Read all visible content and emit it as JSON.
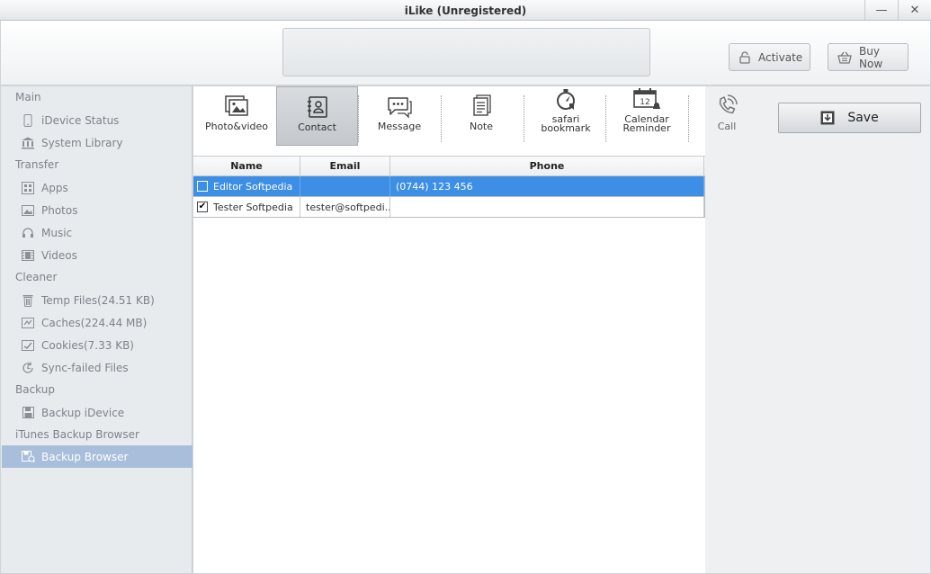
{
  "window": {
    "title": "iLike (Unregistered)",
    "minimize_glyph": "—",
    "close_glyph": "✕"
  },
  "header": {
    "activate_label": "Activate",
    "buy_now_label": "Buy Now"
  },
  "sidebar": {
    "groups": [
      {
        "label": "Main"
      },
      {
        "label": "Transfer"
      },
      {
        "label": "Cleaner"
      },
      {
        "label": "Backup"
      },
      {
        "label": "iTunes Backup Browser"
      }
    ],
    "items": [
      {
        "label": "iDevice Status",
        "icon": "phone-icon"
      },
      {
        "label": "System Library",
        "icon": "library-icon"
      },
      {
        "label": "Apps",
        "icon": "apps-icon"
      },
      {
        "label": "Photos",
        "icon": "photos-icon"
      },
      {
        "label": "Music",
        "icon": "headphones-icon"
      },
      {
        "label": "Videos",
        "icon": "film-icon"
      },
      {
        "label": "Temp Files(24.51 KB)",
        "icon": "trash-icon"
      },
      {
        "label": "Caches(224.44 MB)",
        "icon": "cache-icon"
      },
      {
        "label": "Cookies(7.33 KB)",
        "icon": "cookie-icon"
      },
      {
        "label": "Sync-failed Files",
        "icon": "sync-icon"
      },
      {
        "label": "Backup iDevice",
        "icon": "floppy-icon"
      },
      {
        "label": "Backup Browser",
        "icon": "browser-icon",
        "active": true
      }
    ]
  },
  "toolbar": {
    "tools": [
      {
        "label": "Photo&video",
        "icon": "photo-video-icon"
      },
      {
        "label": "Contact",
        "icon": "contact-icon",
        "active": true
      },
      {
        "label": "Message",
        "icon": "message-icon"
      },
      {
        "label": "Note",
        "icon": "note-icon"
      },
      {
        "label": "safari bookmark",
        "line1": "safari",
        "line2": "bookmark",
        "icon": "compass-icon"
      },
      {
        "label": "Calendar Reminder",
        "line1": "Calendar",
        "line2": "Reminder",
        "icon": "calendar-icon",
        "calendar_day": "12"
      },
      {
        "label": "Call",
        "icon": "call-icon"
      }
    ],
    "save_label": "Save"
  },
  "table": {
    "columns": [
      "Name",
      "Email",
      "Phone"
    ],
    "rows": [
      {
        "name": "Editor Softpedia",
        "email": "",
        "phone": "(0744) 123 456",
        "checked": false,
        "selected": true
      },
      {
        "name": "Tester Softpedia",
        "email": "tester@softpedi...",
        "phone": "",
        "checked": true,
        "selected": false
      }
    ],
    "checkmark_glyph": "✔"
  },
  "colors": {
    "selection": "#3d8ee5",
    "sidebar_active": "#a9bedb",
    "sidebar_bg": "#e8ebee"
  }
}
